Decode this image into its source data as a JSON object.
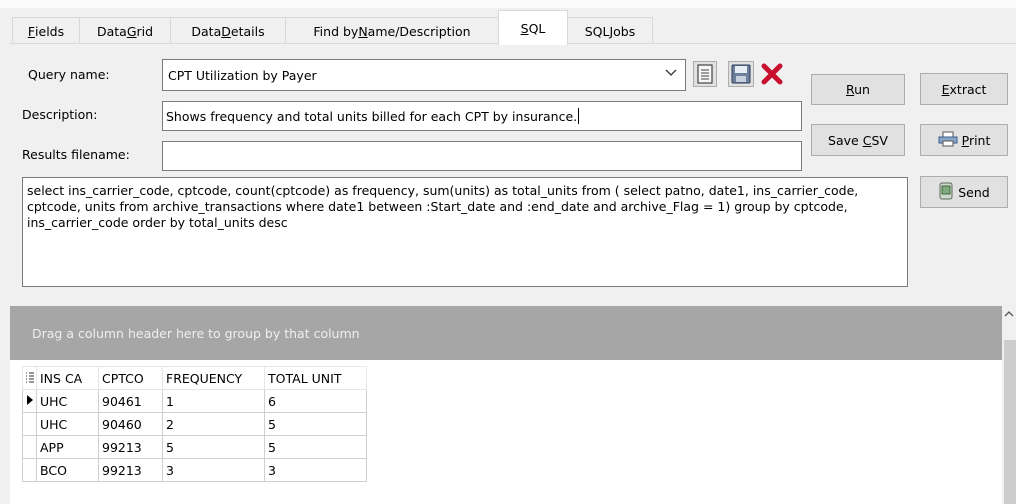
{
  "tabs": [
    {
      "label_pre": "",
      "label_u": "F",
      "label_post": "ields"
    },
    {
      "label_pre": "Data ",
      "label_u": "G",
      "label_post": "rid"
    },
    {
      "label_pre": "Data ",
      "label_u": "D",
      "label_post": "etails"
    },
    {
      "label_pre": "Find by ",
      "label_u": "N",
      "label_post": "ame/Description"
    },
    {
      "label_pre": "",
      "label_u": "S",
      "label_post": "QL"
    },
    {
      "label_pre": "SQL ",
      "label_u": "J",
      "label_post": "obs"
    }
  ],
  "active_tab": "SQL",
  "form": {
    "query_name_label": "Query name:",
    "query_name_value": "CPT Utilization by Payer",
    "description_label": "Description:",
    "description_value": "Shows frequency and total units billed for each CPT by insurance.",
    "results_filename_label": "Results filename:",
    "results_filename_value": "",
    "sql_text": "select ins_carrier_code, cptcode, count(cptcode) as frequency, sum(units) as total_units from ( select patno, date1, ins_carrier_code, cptcode, units from archive_transactions where date1 between :Start_date and :end_date and archive_Flag = 1) group by cptcode, ins_carrier_code order by total_units desc"
  },
  "buttons": {
    "run": {
      "pre": "",
      "u": "R",
      "post": "un"
    },
    "extract": {
      "pre": "",
      "u": "E",
      "post": "xtract"
    },
    "save_csv": {
      "pre": "Save ",
      "u": "C",
      "post": "SV"
    },
    "print": {
      "pre": "",
      "u": "P",
      "post": "rint"
    },
    "send": "Send"
  },
  "icons": {
    "combo_arrow": "chevron-down-icon",
    "new_query": "document-icon",
    "save_query": "floppy-disk-icon",
    "delete_query": "red-x-icon",
    "print": "printer-icon",
    "send": "mail-icon",
    "column_chooser": "column-chooser-icon",
    "row_indicator": "current-row-icon"
  },
  "grid": {
    "group_hint": "Drag a column header here to group by that column",
    "columns": [
      "INS CA",
      "CPTCO",
      "FREQUENCY",
      "TOTAL UNIT"
    ],
    "rows": [
      [
        "UHC",
        "90461",
        "1",
        "6"
      ],
      [
        "UHC",
        "90460",
        "2",
        "5"
      ],
      [
        "APP",
        "99213",
        "5",
        "5"
      ],
      [
        "BCO",
        "99213",
        "3",
        "3"
      ]
    ],
    "current_row": 0
  }
}
